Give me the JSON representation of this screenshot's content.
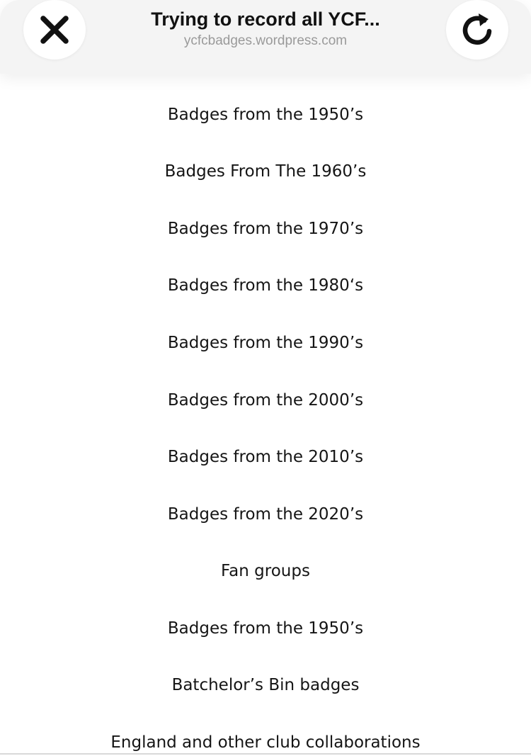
{
  "header": {
    "title": "Trying to record all YCF...",
    "domain": "ycfcbadges.wordpress.com",
    "close_icon": "close-icon",
    "reload_icon": "reload-icon"
  },
  "menu": {
    "items": [
      "Badges from the 1950’s",
      "Badges From The 1960’s",
      "Badges from the 1970’s",
      "Badges from the 1980‘s",
      "Badges from the 1990’s",
      "Badges from the 2000’s",
      "Badges from the 2010’s",
      "Badges from the 2020’s",
      "Fan groups",
      "Badges from the 1950’s",
      "Batchelor’s Bin badges",
      "England and other club collaborations"
    ]
  }
}
